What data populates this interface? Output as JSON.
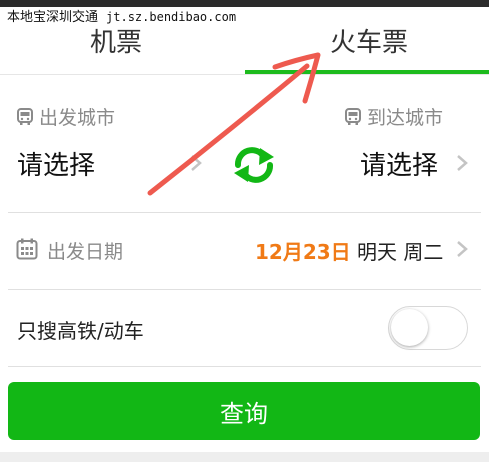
{
  "watermark": {
    "site": "本地宝深圳交通",
    "url": "jt.sz.bendibao.com"
  },
  "tabs": [
    {
      "label": "机票"
    },
    {
      "label": "火车票"
    }
  ],
  "active_tab": "火车票",
  "route": {
    "from": {
      "label": "出发城市",
      "value": "请选择"
    },
    "to": {
      "label": "到达城市",
      "value": "请选择"
    }
  },
  "date": {
    "label": "出发日期",
    "value": "12月23日",
    "day": "明天 周二"
  },
  "high_speed": {
    "label": "只搜高铁/动车",
    "enabled": false
  },
  "search_button": {
    "label": "查询"
  },
  "colors": {
    "accent": "#12b715",
    "date_highlight": "#f07a16",
    "annotation": "#ee5a4f"
  }
}
